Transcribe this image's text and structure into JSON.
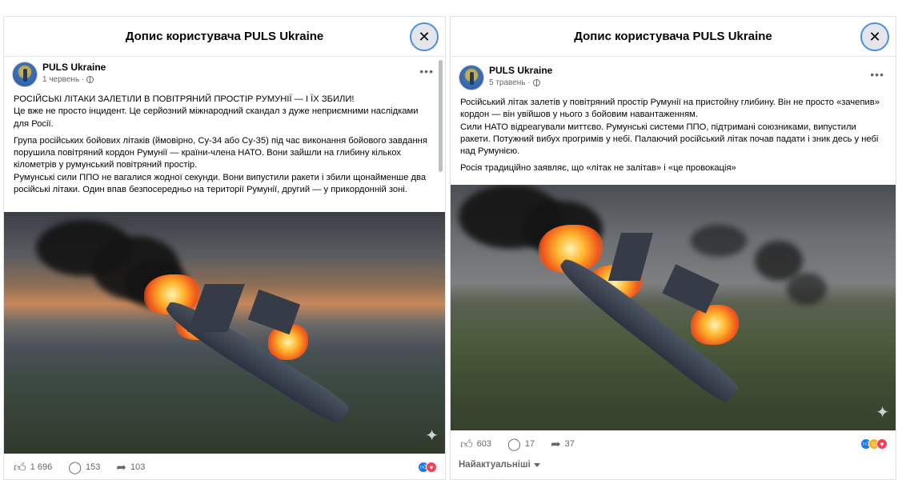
{
  "left_post": {
    "header_title": "Допис користувача PULS Ukraine",
    "author": "PULS Ukraine",
    "date": "1 червень ·",
    "paragraphs": [
      "РОСІЙСЬКІ ЛІТАКИ ЗАЛЕТІЛИ В ПОВІТРЯНИЙ ПРОСТІР РУМУНІЇ — І ЇХ ЗБИЛИ!\nЦе вже не просто інцидент. Це серйозний міжнародний скандал з дуже неприємними наслідками для Росії.",
      "Група російських бойових літаків (ймовірно, Су-34 або Су-35) під час виконання бойового завдання порушила повітряний кордон Румунії — країни-члена НАТО. Вони зайшли на глибину кількох кілометрів у румунський повітряний простір.\nРумунські сили ППО не вагалися жодної секунди. Вони випустили ракети і збили щонайменше два російські літаки. Один впав безпосередньо на території Румунії, другий — у прикордонній зоні."
    ],
    "likes": "1 696",
    "comments": "153",
    "shares": "103"
  },
  "right_post": {
    "header_title": "Допис користувача PULS Ukraine",
    "author": "PULS Ukraine",
    "date": "5 травень ·",
    "paragraphs": [
      "Російський літак залетів у повітряний простір Румунії на пристойну глибину. Він не просто «зачепив» кордон — він увійшов у нього з бойовим навантаженням.\nСили НАТО відреагували миттєво. Румунські системи ППО, підтримані союзниками, випустили ракети. Потужний вибух прогримів у небі. Палаючий російський літак почав падати і зник десь у небі над Румунією.",
      "Росія традиційно заявляє, що «літак не залітав» і «це провокація»"
    ],
    "likes": "603",
    "comments": "17",
    "shares": "37",
    "sort_label": "Найактуальніші"
  },
  "icons": {
    "close": "close-icon",
    "more": "more-options-icon",
    "like": "thumbs-up-icon",
    "comment": "comment-bubble-icon",
    "share": "share-arrow-icon",
    "globe": "globe-icon",
    "sparkle": "sparkle-icon"
  },
  "colors": {
    "like_blue": "#1877f2",
    "haha_yellow": "#f7b125",
    "love_red": "#f33e58",
    "close_ring": "#4a90e2"
  }
}
